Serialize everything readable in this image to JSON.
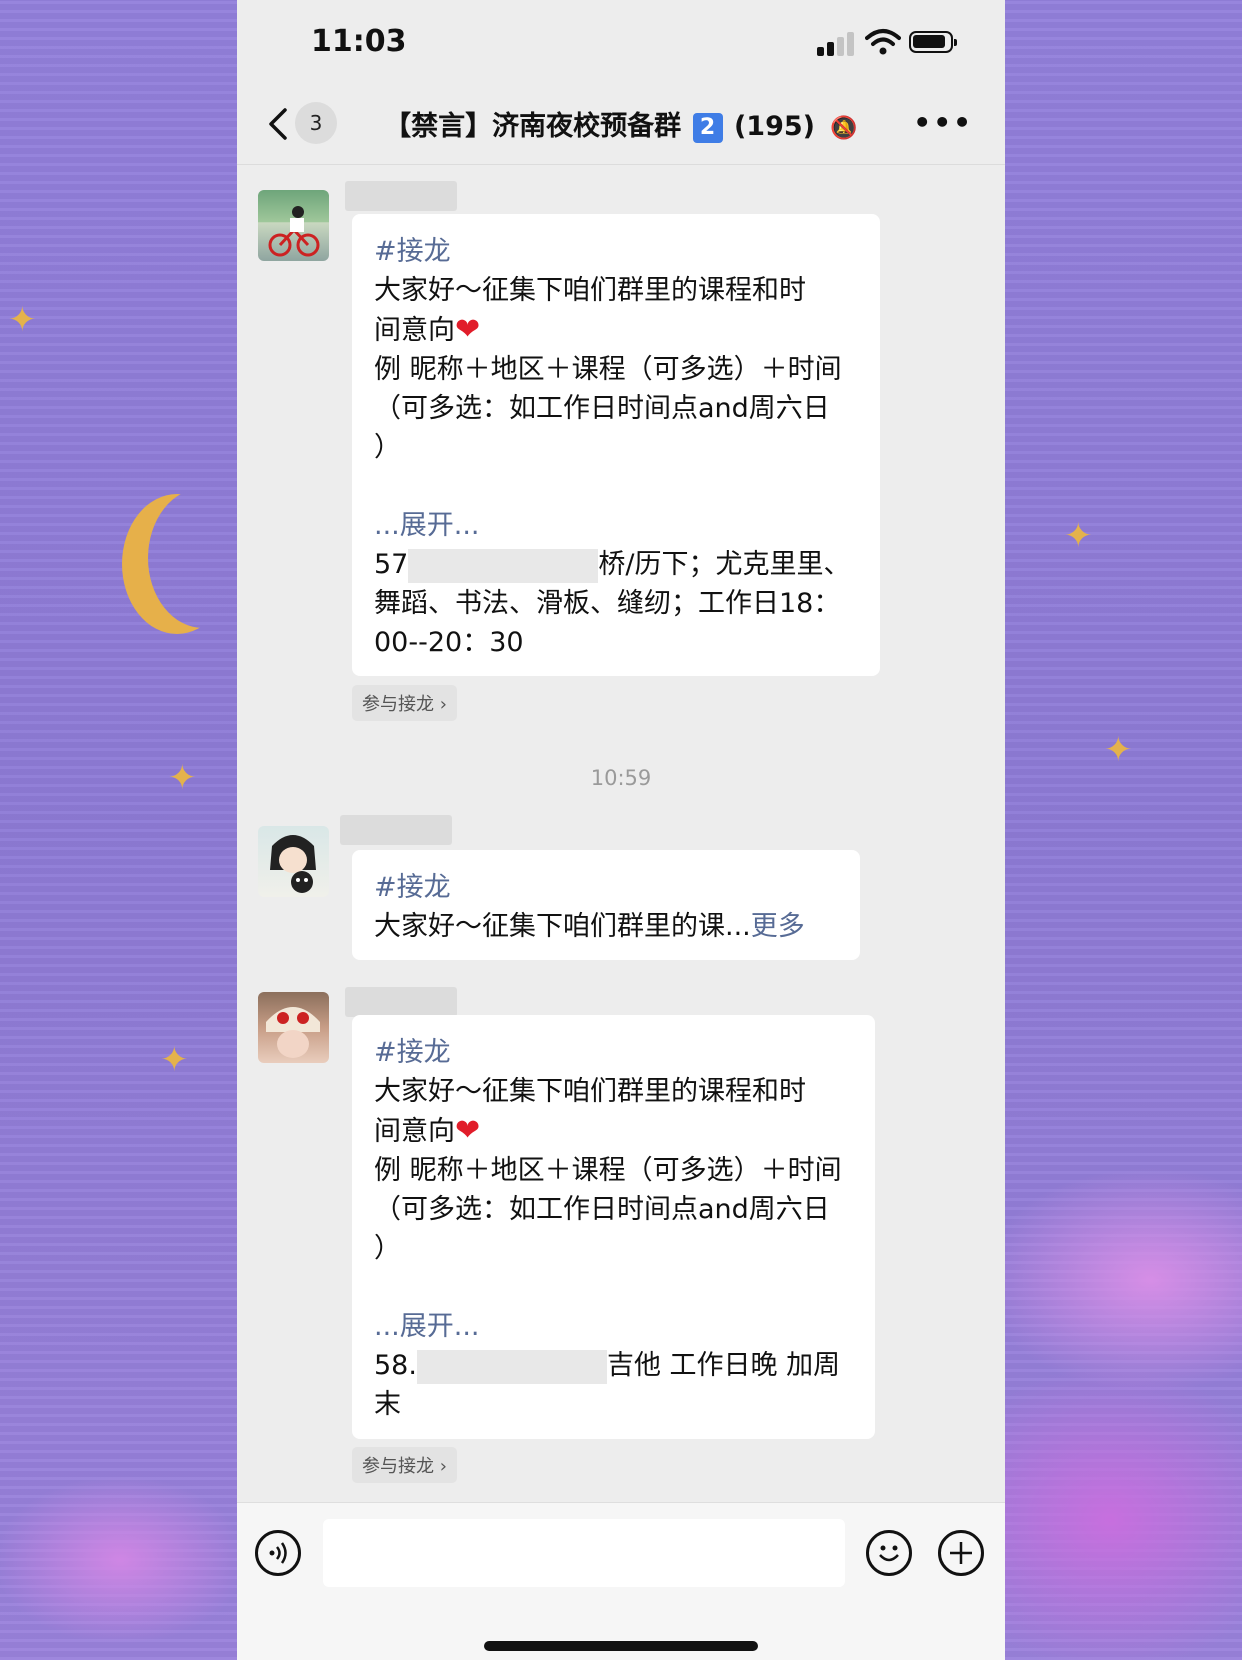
{
  "status_bar": {
    "time": "11:03"
  },
  "nav": {
    "back_count": "3",
    "title_prefix": "【禁言】济南夜校预备群",
    "title_number": "2",
    "title_count": "(195)"
  },
  "messages": [
    {
      "tag": "#接龙",
      "line1": "大家好～征集下咱们群里的课程和时",
      "line2": "间意向",
      "line3": "例 昵称＋地区＋课程（可多选）＋时间",
      "line4": "（可多选：如工作日时间点and周六日",
      "line5": "）",
      "expand": "...展开...",
      "entry_line1_prefix": "57",
      "entry_line1_suffix": "桥/历下；尤克里里、",
      "entry_line2": "舞蹈、书法、滑板、缝纫；工作日18：",
      "entry_line3": "00--20：30",
      "join": "参与接龙 ›"
    },
    {
      "tag": "#接龙",
      "preview": "大家好～征集下咱们群里的课...",
      "more": "更多"
    },
    {
      "tag": "#接龙",
      "line1": "大家好～征集下咱们群里的课程和时",
      "line2": "间意向",
      "line3": "例 昵称＋地区＋课程（可多选）＋时间",
      "line4": "（可多选：如工作日时间点and周六日",
      "line5": "）",
      "expand": "...展开...",
      "entry_line1_prefix": "58.",
      "entry_line1_suffix": "吉他 工作日晚 加周",
      "entry_line2": "末",
      "join": "参与接龙 ›"
    }
  ],
  "timestamp": "10:59",
  "colors": {
    "link": "#576b95",
    "background": "#ededed",
    "bubble": "#ffffff"
  }
}
